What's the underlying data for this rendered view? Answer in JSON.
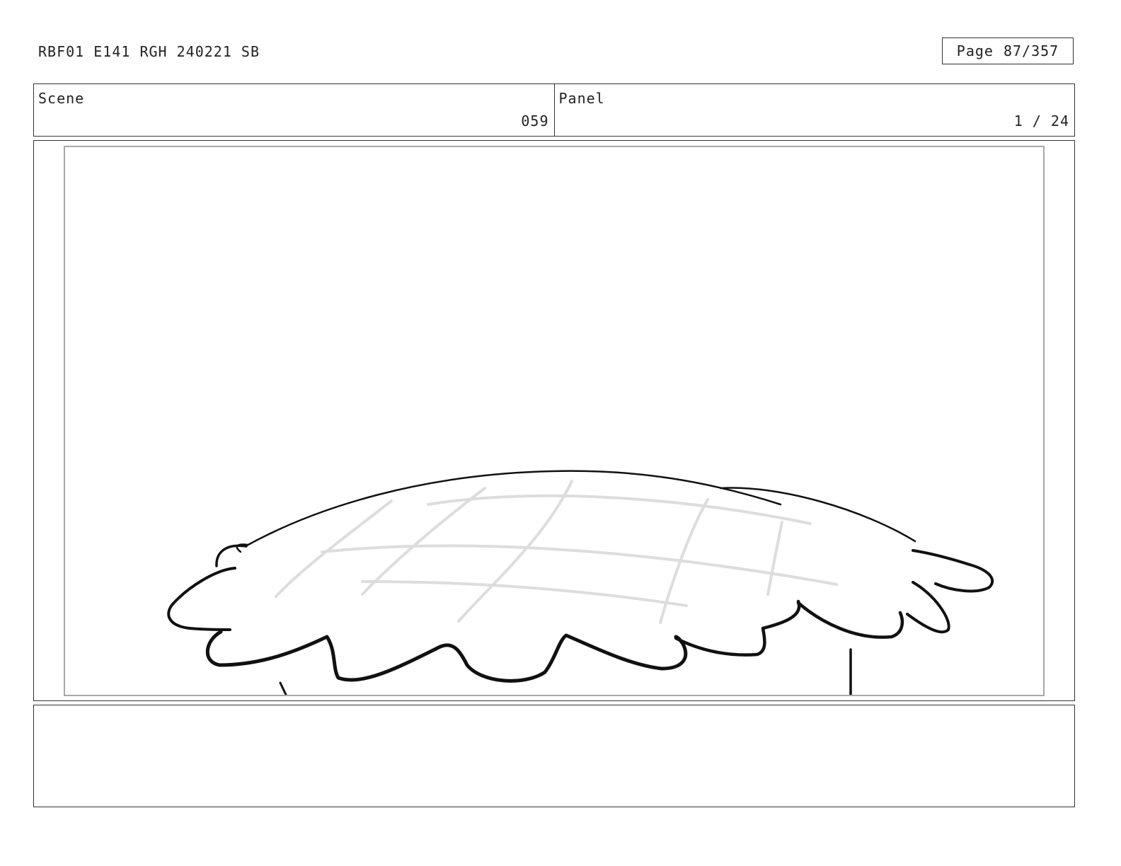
{
  "header": {
    "doc_title": "RBF01 E141 RGH 240221 SB",
    "page_label": "Page",
    "page_number": "87/357"
  },
  "scene": {
    "label": "Scene",
    "value": "059"
  },
  "panel": {
    "label": "Panel",
    "value": "1 / 24"
  },
  "drawing": {
    "subject": "bush-sketch",
    "stroke_color": "#111111",
    "guide_color": "#dddddd"
  },
  "notes": {
    "text": ""
  }
}
